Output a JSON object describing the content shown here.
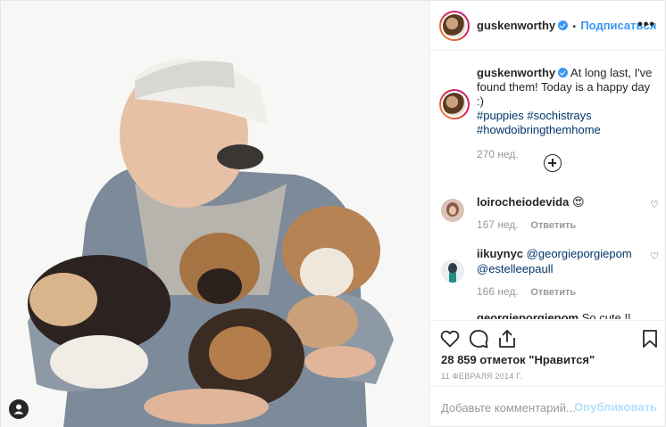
{
  "post": {
    "photo_alt": "",
    "author": {
      "username": "guskenworthy",
      "verified": true,
      "follow_label": "Подписаться",
      "separator": "•"
    },
    "more_label": "•••",
    "caption": {
      "username": "guskenworthy",
      "text": "At long last, I've found them! Today is a happy day :)",
      "hashtags": [
        "#puppies",
        "#sochistrays",
        "#howdoibringthemhome"
      ],
      "age": "270 нед."
    },
    "comments": [
      {
        "username": "loirocheiodevida",
        "text": "😍",
        "age": "167 нед.",
        "reply_label": "Ответить"
      },
      {
        "username": "iikuynyc",
        "text": "@georgieporgiepom @estelleepaull",
        "mention1": "@georgieporgiepom",
        "mention2": "@estelleepaull",
        "age": "166 нед.",
        "reply_label": "Ответить"
      },
      {
        "username": "georgieporgiepom",
        "text": "So cute !!"
      }
    ],
    "likes": "28 859 отметок \"Нравится\"",
    "date": "11 ФЕВРАЛЯ 2014 Г.",
    "comment_input": {
      "placeholder": "Добавьте комментарий...",
      "value": ""
    },
    "publish_label": "Опубликовать"
  },
  "icons": {
    "like": "heart-icon",
    "comment": "comment-icon",
    "share": "share-icon",
    "save": "bookmark-icon",
    "tags": "user-tag-icon",
    "load_more": "plus-circle-icon"
  },
  "colors": {
    "link": "#3897f0",
    "tag": "#003569",
    "muted": "#999999",
    "publish_disabled": "#b2dffc"
  }
}
